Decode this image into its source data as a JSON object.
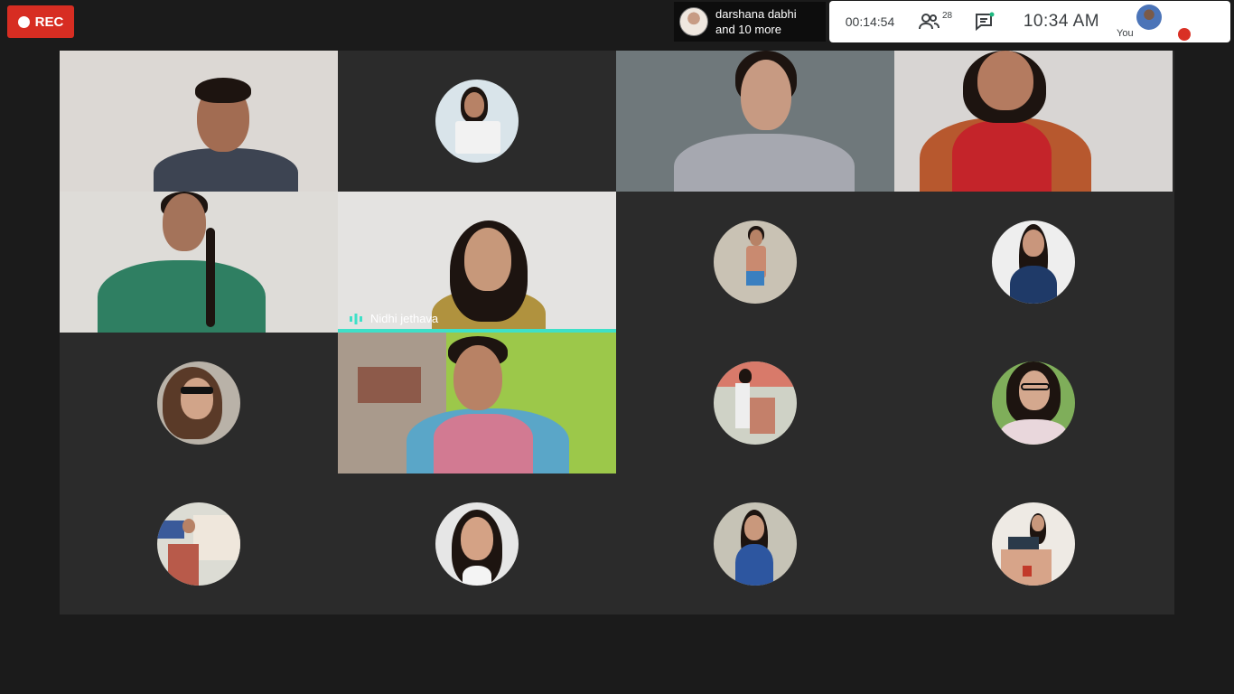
{
  "recording": {
    "label": "REC"
  },
  "presenter": {
    "name": "darshana dabhi",
    "more": "and 10 more"
  },
  "topbar": {
    "elapsed": "00:14:54",
    "participant_count": "28",
    "clock": "10:34  AM",
    "self_label": "You"
  },
  "tiles": [
    {
      "type": "video"
    },
    {
      "type": "avatar"
    },
    {
      "type": "video"
    },
    {
      "type": "video"
    },
    {
      "type": "video"
    },
    {
      "type": "video",
      "name": "Nidhi jethava",
      "speaking": true
    },
    {
      "type": "avatar"
    },
    {
      "type": "avatar"
    },
    {
      "type": "avatar"
    },
    {
      "type": "video"
    },
    {
      "type": "avatar"
    },
    {
      "type": "avatar"
    },
    {
      "type": "avatar"
    },
    {
      "type": "avatar"
    },
    {
      "type": "avatar"
    },
    {
      "type": "avatar"
    }
  ],
  "colors": {
    "rec": "#d72d22",
    "speaking_accent": "#3ee0c8",
    "grid_bg": "#2b2b2b",
    "page_bg": "#1b1b1b"
  }
}
